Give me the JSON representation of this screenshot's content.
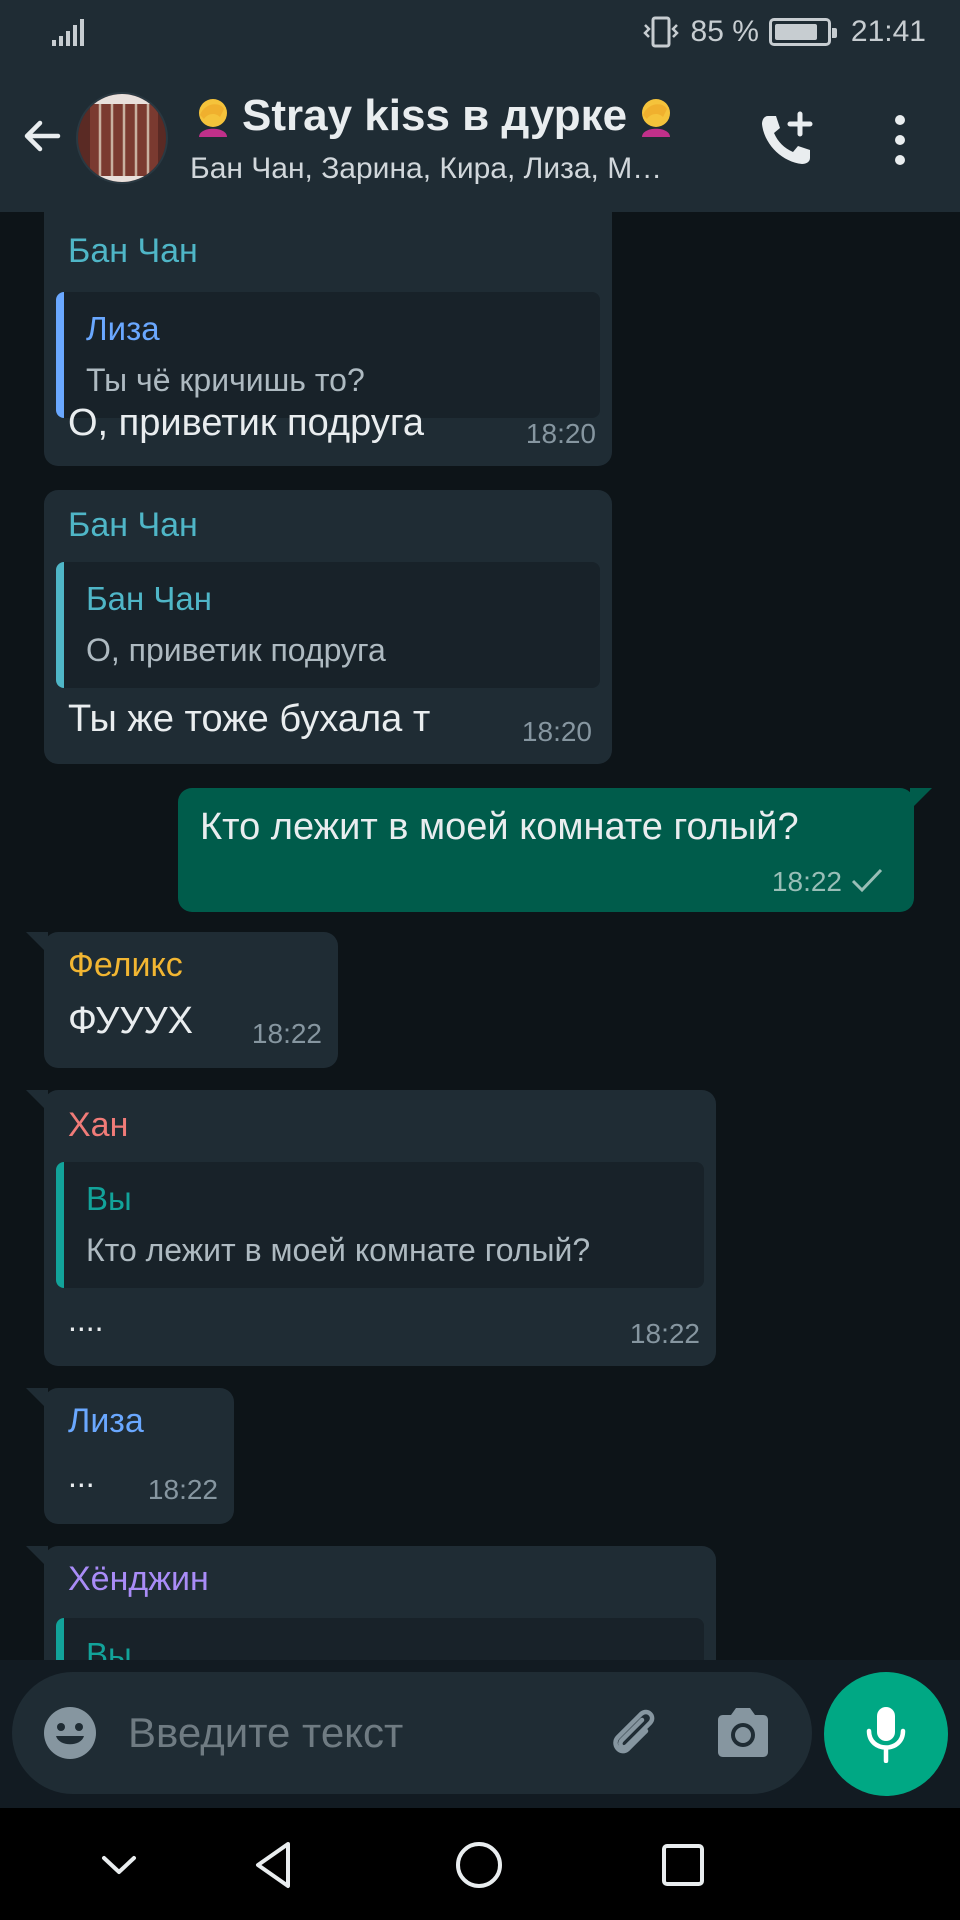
{
  "status_bar": {
    "battery_text": "85 %",
    "battery_level": 0.85,
    "time": "21:41"
  },
  "header": {
    "title": "Stray kiss в дурке",
    "title_emoji": "facepalm-emoji",
    "subtitle": "Бан Чан, Зарина, Кира, Лиза, М…"
  },
  "colors": {
    "ban_chan": "#4fb6c7",
    "liza": "#6aa8ff",
    "you": "#12a39a",
    "feliks": "#f2b632",
    "han": "#f07b78",
    "hyunjin": "#a98cf7",
    "accent": "#00a884"
  },
  "messages": [
    {
      "sender": "Бан Чан",
      "quote_sender": "Лиза",
      "quote_text": "Ты чё кричишь то?",
      "text": "О,  приветик подруга",
      "time": "18:20"
    },
    {
      "sender": "Бан Чан",
      "quote_sender": "Бан Чан",
      "quote_text": "О,  приветик подруга",
      "text": "Ты же тоже бухала т",
      "time": "18:20"
    },
    {
      "text": "Кто лежит в моей комнате голый?",
      "time": "18:22",
      "status": "sent-check-icon"
    },
    {
      "sender": "Феликс",
      "text": "ФУУУХ",
      "time": "18:22"
    },
    {
      "sender": "Хан",
      "quote_sender": "Вы",
      "quote_text": "Кто лежит в моей комнате голый?",
      "text": "....",
      "time": "18:22"
    },
    {
      "sender": "Лиза",
      "text": "...",
      "time": "18:22"
    },
    {
      "sender": "Хёнджин",
      "quote_sender": "Вы"
    }
  ],
  "composer": {
    "placeholder": "Введите текст"
  }
}
